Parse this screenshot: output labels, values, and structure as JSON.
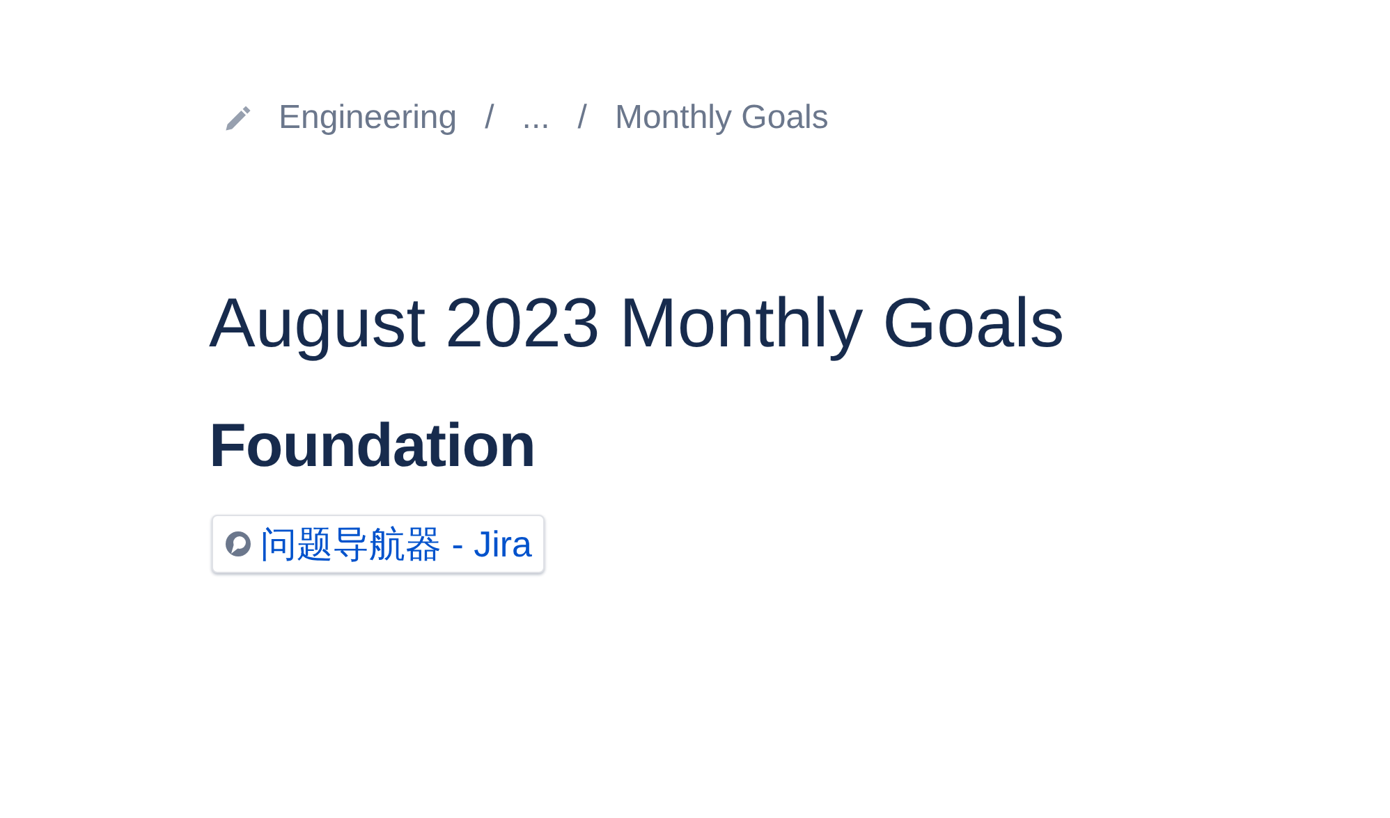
{
  "breadcrumbs": [
    "Engineering",
    "...",
    "Monthly Goals"
  ],
  "breadcrumb_separator": "/",
  "title": "August 2023 Monthly Goals",
  "heading": "Foundation",
  "smart_link": {
    "label": "问题导航器 - Jira"
  }
}
